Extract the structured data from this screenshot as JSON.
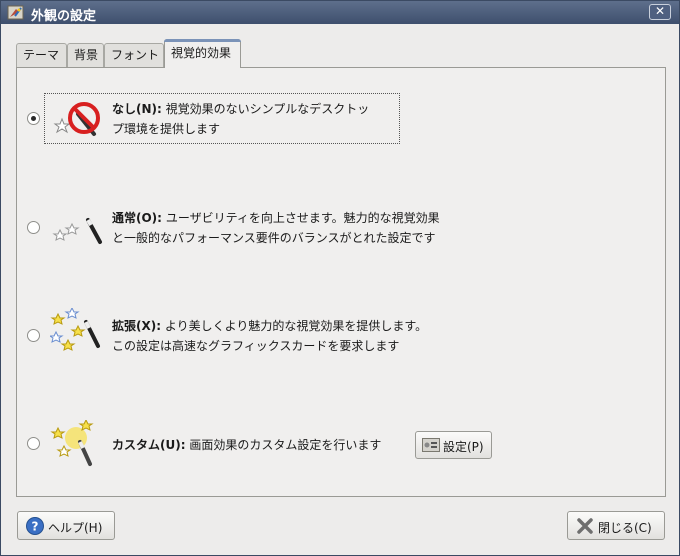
{
  "window": {
    "title": "外観の設定",
    "close_glyph": "✕"
  },
  "tabs": [
    {
      "label": "テーマ"
    },
    {
      "label": "背景"
    },
    {
      "label": "フォント"
    },
    {
      "label": "視覚的効果",
      "active": true
    }
  ],
  "options": [
    {
      "title": "なし(N):",
      "mnemonic": "N",
      "line1": "視覚効果のないシンプルなデスクトッ",
      "line2": "プ環境を提供します",
      "selected": true,
      "icon": "no-effects-icon"
    },
    {
      "title": "通常(O):",
      "mnemonic": "O",
      "line1": "ユーザビリティを向上させます。魅力的な視覚効果",
      "line2": "と一般的なパフォーマンス要件のバランスがとれた設定です",
      "selected": false,
      "icon": "normal-effects-icon"
    },
    {
      "title": "拡張(X):",
      "mnemonic": "X",
      "line1": "より美しくより魅力的な視覚効果を提供します。",
      "line2": "この設定は高速なグラフィックスカードを要求します",
      "selected": false,
      "icon": "extra-effects-icon"
    },
    {
      "title": "カスタム(U):",
      "mnemonic": "U",
      "line1": "画面効果のカスタム設定を行います",
      "line2": "",
      "selected": false,
      "icon": "custom-effects-icon"
    }
  ],
  "custom_settings_button": {
    "label": "設定(P)"
  },
  "help_button": {
    "label": "ヘルプ(H)"
  },
  "close_button": {
    "label": "閉じる(C)"
  },
  "colors": {
    "titlebar": "#4a5b78",
    "panel": "#f0efee",
    "window": "#edeceb",
    "tab_accent": "#7b93b8"
  }
}
